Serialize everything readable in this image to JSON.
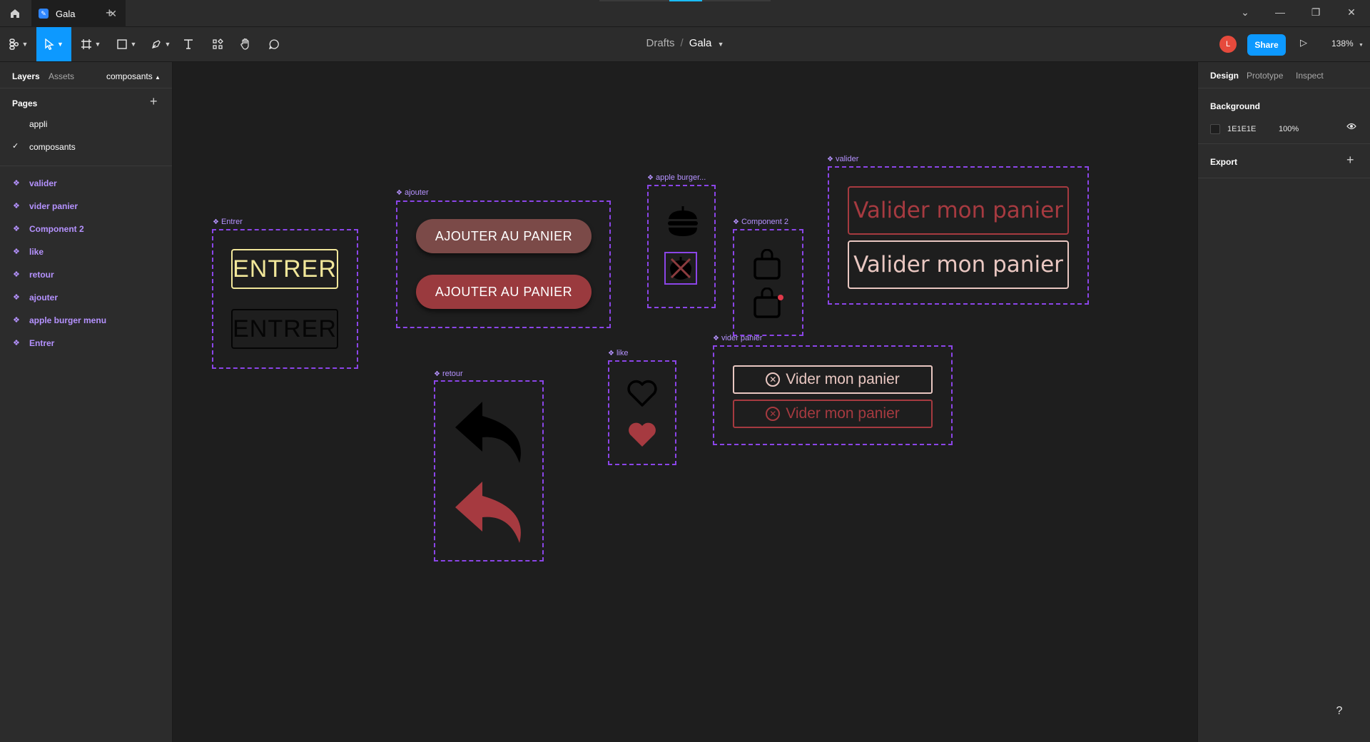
{
  "titlebar": {
    "tab_title": "Gala",
    "tab_close": "✕",
    "tab_add": "+"
  },
  "toolbar": {
    "breadcrumb_root": "Drafts",
    "breadcrumb_sep": "/",
    "file_name": "Gala",
    "avatar_initial": "L",
    "share_label": "Share",
    "zoom_level": "138%"
  },
  "left_panel": {
    "tabs": [
      "Layers",
      "Assets"
    ],
    "current_page_selector": "composants",
    "pages_title": "Pages",
    "pages": [
      {
        "label": "appli",
        "selected": false
      },
      {
        "label": "composants",
        "selected": true
      }
    ],
    "layers": [
      "valider",
      "vider panier",
      "Component 2",
      "like",
      "retour",
      "ajouter",
      "apple burger menu",
      "Entrer"
    ]
  },
  "right_panel": {
    "tabs": [
      "Design",
      "Prototype",
      "Inspect"
    ],
    "background_title": "Background",
    "background_hex": "1E1E1E",
    "background_opacity": "100%",
    "export_title": "Export"
  },
  "canvas": {
    "components": {
      "entrer": {
        "label": "Entrer",
        "button_text": "ENTRER"
      },
      "ajouter": {
        "label": "ajouter",
        "button_text": "AJOUTER AU PANIER"
      },
      "apple_burger": {
        "label": "apple burger..."
      },
      "component2": {
        "label": "Component 2"
      },
      "valider": {
        "label": "valider",
        "button_text": "Valider mon panier"
      },
      "retour": {
        "label": "retour"
      },
      "like": {
        "label": "like"
      },
      "vider": {
        "label": "vider panier",
        "button_text": "Vider mon panier"
      }
    }
  },
  "colors": {
    "accent": "#0d99ff",
    "component_border": "#8b45e8",
    "brand_red": "#a63a40",
    "cream": "#e9c7c1",
    "yellow": "#f1e79a"
  },
  "help_label": "?"
}
